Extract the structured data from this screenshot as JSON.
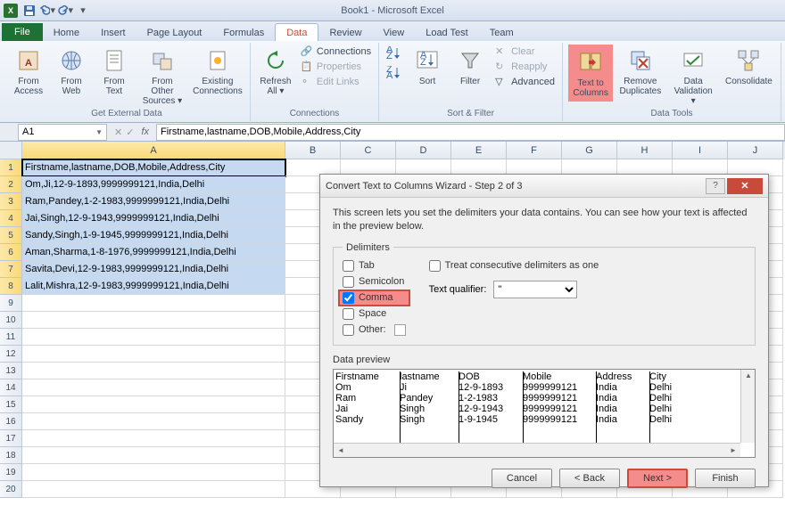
{
  "title": "Book1 - Microsoft Excel",
  "tabs": {
    "file": "File",
    "home": "Home",
    "insert": "Insert",
    "pagelayout": "Page Layout",
    "formulas": "Formulas",
    "data": "Data",
    "review": "Review",
    "view": "View",
    "loadtest": "Load Test",
    "team": "Team"
  },
  "ribbon": {
    "ext": {
      "access": "From\nAccess",
      "web": "From\nWeb",
      "text": "From\nText",
      "other": "From Other\nSources ▾",
      "existing": "Existing\nConnections",
      "label": "Get External Data"
    },
    "conn": {
      "refresh": "Refresh\nAll ▾",
      "connections": "Connections",
      "properties": "Properties",
      "editlinks": "Edit Links",
      "label": "Connections"
    },
    "sort": {
      "sort": "Sort",
      "filter": "Filter",
      "clear": "Clear",
      "reapply": "Reapply",
      "advanced": "Advanced",
      "label": "Sort & Filter"
    },
    "tools": {
      "ttc": "Text to\nColumns",
      "dup": "Remove\nDuplicates",
      "val": "Data\nValidation ▾",
      "cons": "Consolidate",
      "label": "Data Tools"
    }
  },
  "namebox": "A1",
  "formula": "Firstname,lastname,DOB,Mobile,Address,City",
  "cols": [
    "A",
    "B",
    "C",
    "D",
    "E",
    "F",
    "G",
    "H",
    "I",
    "J"
  ],
  "rows": [
    "Firstname,lastname,DOB,Mobile,Address,City",
    "Om,Ji,12-9-1893,9999999121,India,Delhi",
    "Ram,Pandey,1-2-1983,9999999121,India,Delhi",
    "Jai,Singh,12-9-1943,9999999121,India,Delhi",
    "Sandy,Singh,1-9-1945,9999999121,India,Delhi",
    "Aman,Sharma,1-8-1976,9999999121,India,Delhi",
    "Savita,Devi,12-9-1983,9999999121,India,Delhi",
    "Lalit,Mishra,12-9-1983,9999999121,India,Delhi"
  ],
  "dialog": {
    "title": "Convert Text to Columns Wizard - Step 2 of 3",
    "desc": "This screen lets you set the delimiters your data contains.  You can see how your text is affected in the preview below.",
    "delim_legend": "Delimiters",
    "tab": "Tab",
    "semicolon": "Semicolon",
    "comma": "Comma",
    "space": "Space",
    "other": "Other:",
    "treat": "Treat consecutive delimiters as one",
    "qualifier_label": "Text qualifier:",
    "qualifier_value": "\"",
    "preview_legend": "Data preview",
    "preview": [
      [
        "Firstname",
        "lastname",
        "DOB",
        "Mobile",
        "Address",
        "City"
      ],
      [
        "Om",
        "Ji",
        "12-9-1893",
        "9999999121",
        "India",
        "Delhi"
      ],
      [
        "Ram",
        "Pandey",
        "1-2-1983",
        "9999999121",
        "India",
        "Delhi"
      ],
      [
        "Jai",
        "Singh",
        "12-9-1943",
        "9999999121",
        "India",
        "Delhi"
      ],
      [
        "Sandy",
        "Singh",
        "1-9-1945",
        "9999999121",
        "India",
        "Delhi"
      ]
    ],
    "cancel": "Cancel",
    "back": "< Back",
    "next": "Next >",
    "finish": "Finish"
  }
}
